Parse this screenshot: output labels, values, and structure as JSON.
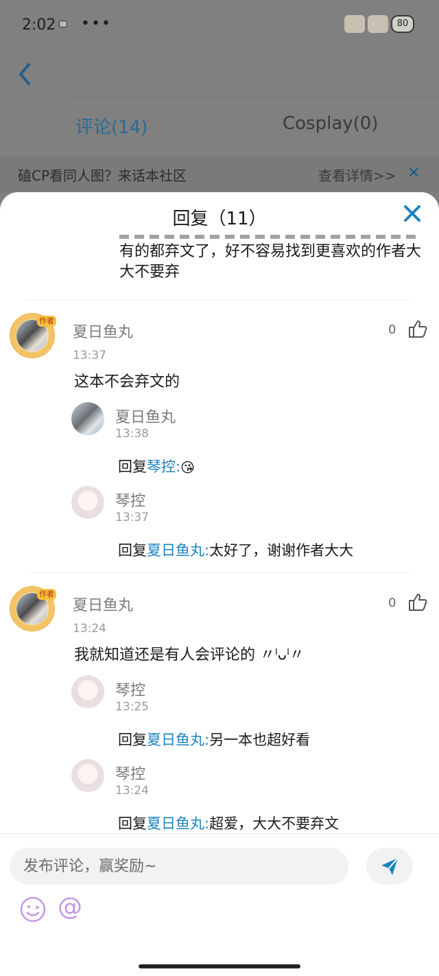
{
  "status_bar": {
    "time": "2:02",
    "dots": "•••",
    "battery": "80"
  },
  "header": {
    "tabs": [
      {
        "label": "评论(14)"
      },
      {
        "label": "Cosplay(0)"
      }
    ],
    "promo": {
      "text": "磕CP看同人图？来话本社区",
      "link": "查看详情>>",
      "close": "✕"
    }
  },
  "sheet": {
    "title": "回复（11）",
    "prev_comment_text": "有的都弃文了，好不容易找到更喜欢的作者大大不要弃",
    "comments": [
      {
        "author": "夏日鱼丸",
        "author_tag": "作者",
        "time": "13:37",
        "text": "这本不会弃文的",
        "likes": "0",
        "replies": [
          {
            "author": "夏日鱼丸",
            "time": "13:38",
            "prefix": "回复",
            "target": "琴控:",
            "text": "",
            "emoji": "😘"
          },
          {
            "author": "琴控",
            "time": "13:37",
            "prefix": "回复",
            "target": "夏日鱼丸:",
            "text": "太好了，谢谢作者大大",
            "emoji": ""
          }
        ]
      },
      {
        "author": "夏日鱼丸",
        "author_tag": "作者",
        "time": "13:24",
        "text": "我就知道还是有人会评论的 〃ˡᴗˡ〃",
        "likes": "0",
        "replies": [
          {
            "author": "琴控",
            "time": "13:25",
            "prefix": "回复",
            "target": "夏日鱼丸:",
            "text": "另一本也超好看",
            "emoji": ""
          },
          {
            "author": "琴控",
            "time": "13:24",
            "prefix": "回复",
            "target": "夏日鱼丸:",
            "text": "超爱，大大不要弃文",
            "emoji": ""
          }
        ]
      }
    ]
  },
  "input": {
    "placeholder": "发布评论，赢奖励~",
    "at_symbol": "@"
  },
  "colors": {
    "accent": "#1c82c0",
    "author_ring": "#f3c466",
    "emoji_purple": "#c596e4"
  }
}
